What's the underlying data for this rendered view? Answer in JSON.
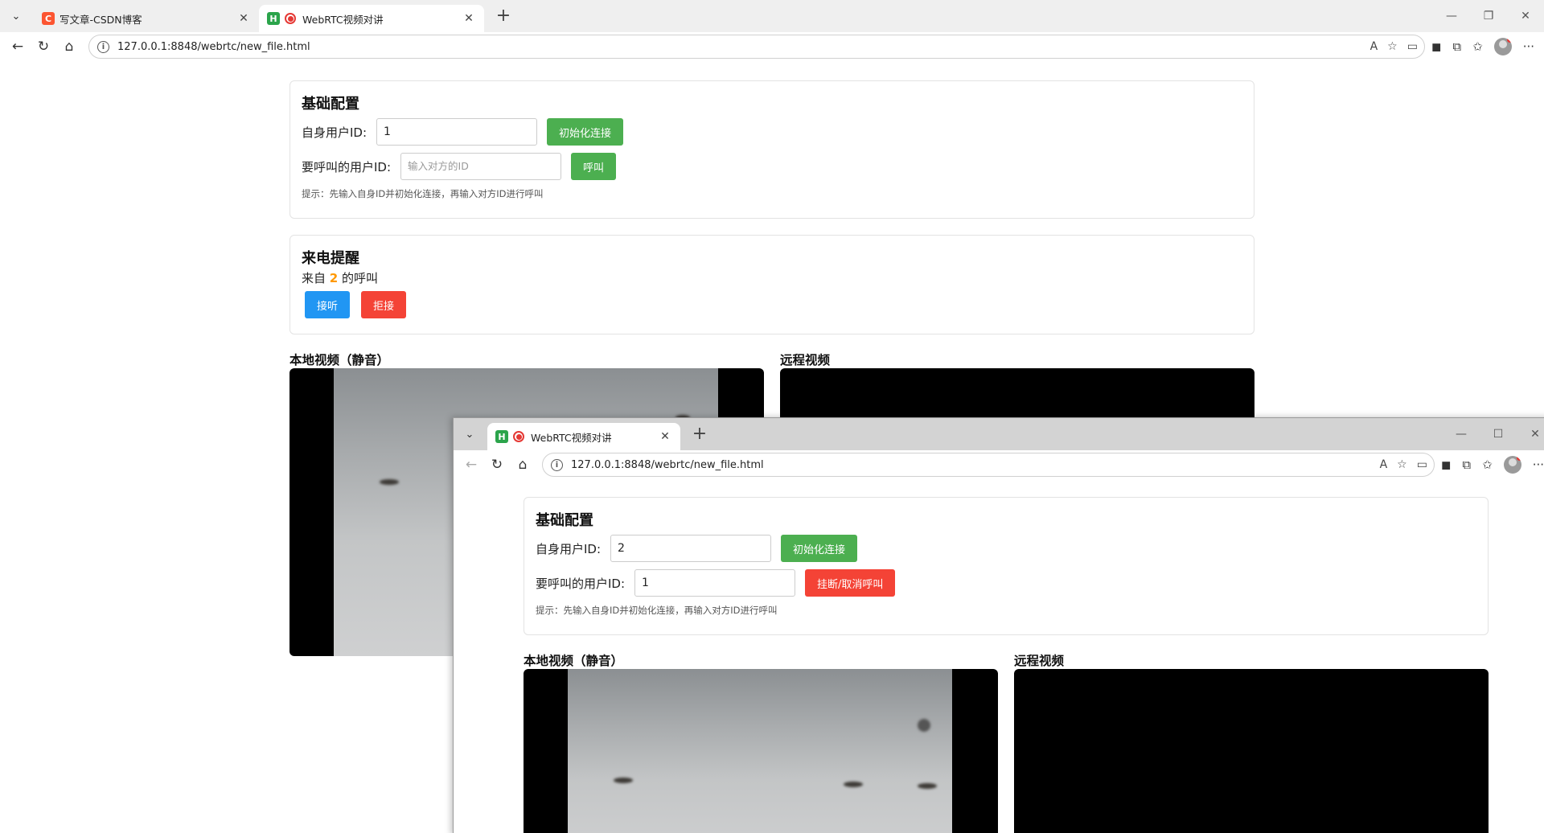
{
  "window1": {
    "tabs": [
      {
        "title": "写文章-CSDN博客",
        "favicon": "C"
      },
      {
        "title": "WebRTC视频对讲",
        "favicon": "H"
      }
    ],
    "url": "127.0.0.1:8848/webrtc/new_file.html",
    "config": {
      "title": "基础配置",
      "self_id_label": "自身用户ID:",
      "self_id_value": "1",
      "init_button": "初始化连接",
      "target_id_label": "要呼叫的用户ID:",
      "target_id_placeholder": "输入对方的ID",
      "call_button": "呼叫",
      "hint": "提示：先输入自身ID并初始化连接，再输入对方ID进行呼叫"
    },
    "incoming": {
      "title": "来电提醒",
      "prefix": "来自",
      "caller_id": "2",
      "suffix": "的呼叫",
      "accept_button": "接听",
      "reject_button": "拒接"
    },
    "local_video_title": "本地视频（静音）",
    "remote_video_title": "远程视频"
  },
  "window2": {
    "tabs": [
      {
        "title": "WebRTC视频对讲",
        "favicon": "H"
      }
    ],
    "url": "127.0.0.1:8848/webrtc/new_file.html",
    "config": {
      "title": "基础配置",
      "self_id_label": "自身用户ID:",
      "self_id_value": "2",
      "init_button": "初始化连接",
      "target_id_label": "要呼叫的用户ID:",
      "target_id_value": "1",
      "hangup_button": "挂断/取消呼叫",
      "hint": "提示：先输入自身ID并初始化连接，再输入对方ID进行呼叫"
    },
    "local_video_title": "本地视频（静音）",
    "remote_video_title": "远程视频"
  },
  "colors": {
    "green": "#4caf50",
    "red": "#f44336",
    "blue": "#2196f3",
    "caller_highlight": "#ff9800"
  },
  "icons": [
    "chevron-down-icon",
    "close-icon",
    "plus-icon",
    "back-icon",
    "refresh-icon",
    "home-icon",
    "info-icon",
    "read-aloud-icon",
    "favorite-icon",
    "camera-icon",
    "extensions-icon",
    "favorites-list-icon",
    "avatar",
    "more-icon",
    "minimize-icon",
    "maximize-icon"
  ]
}
